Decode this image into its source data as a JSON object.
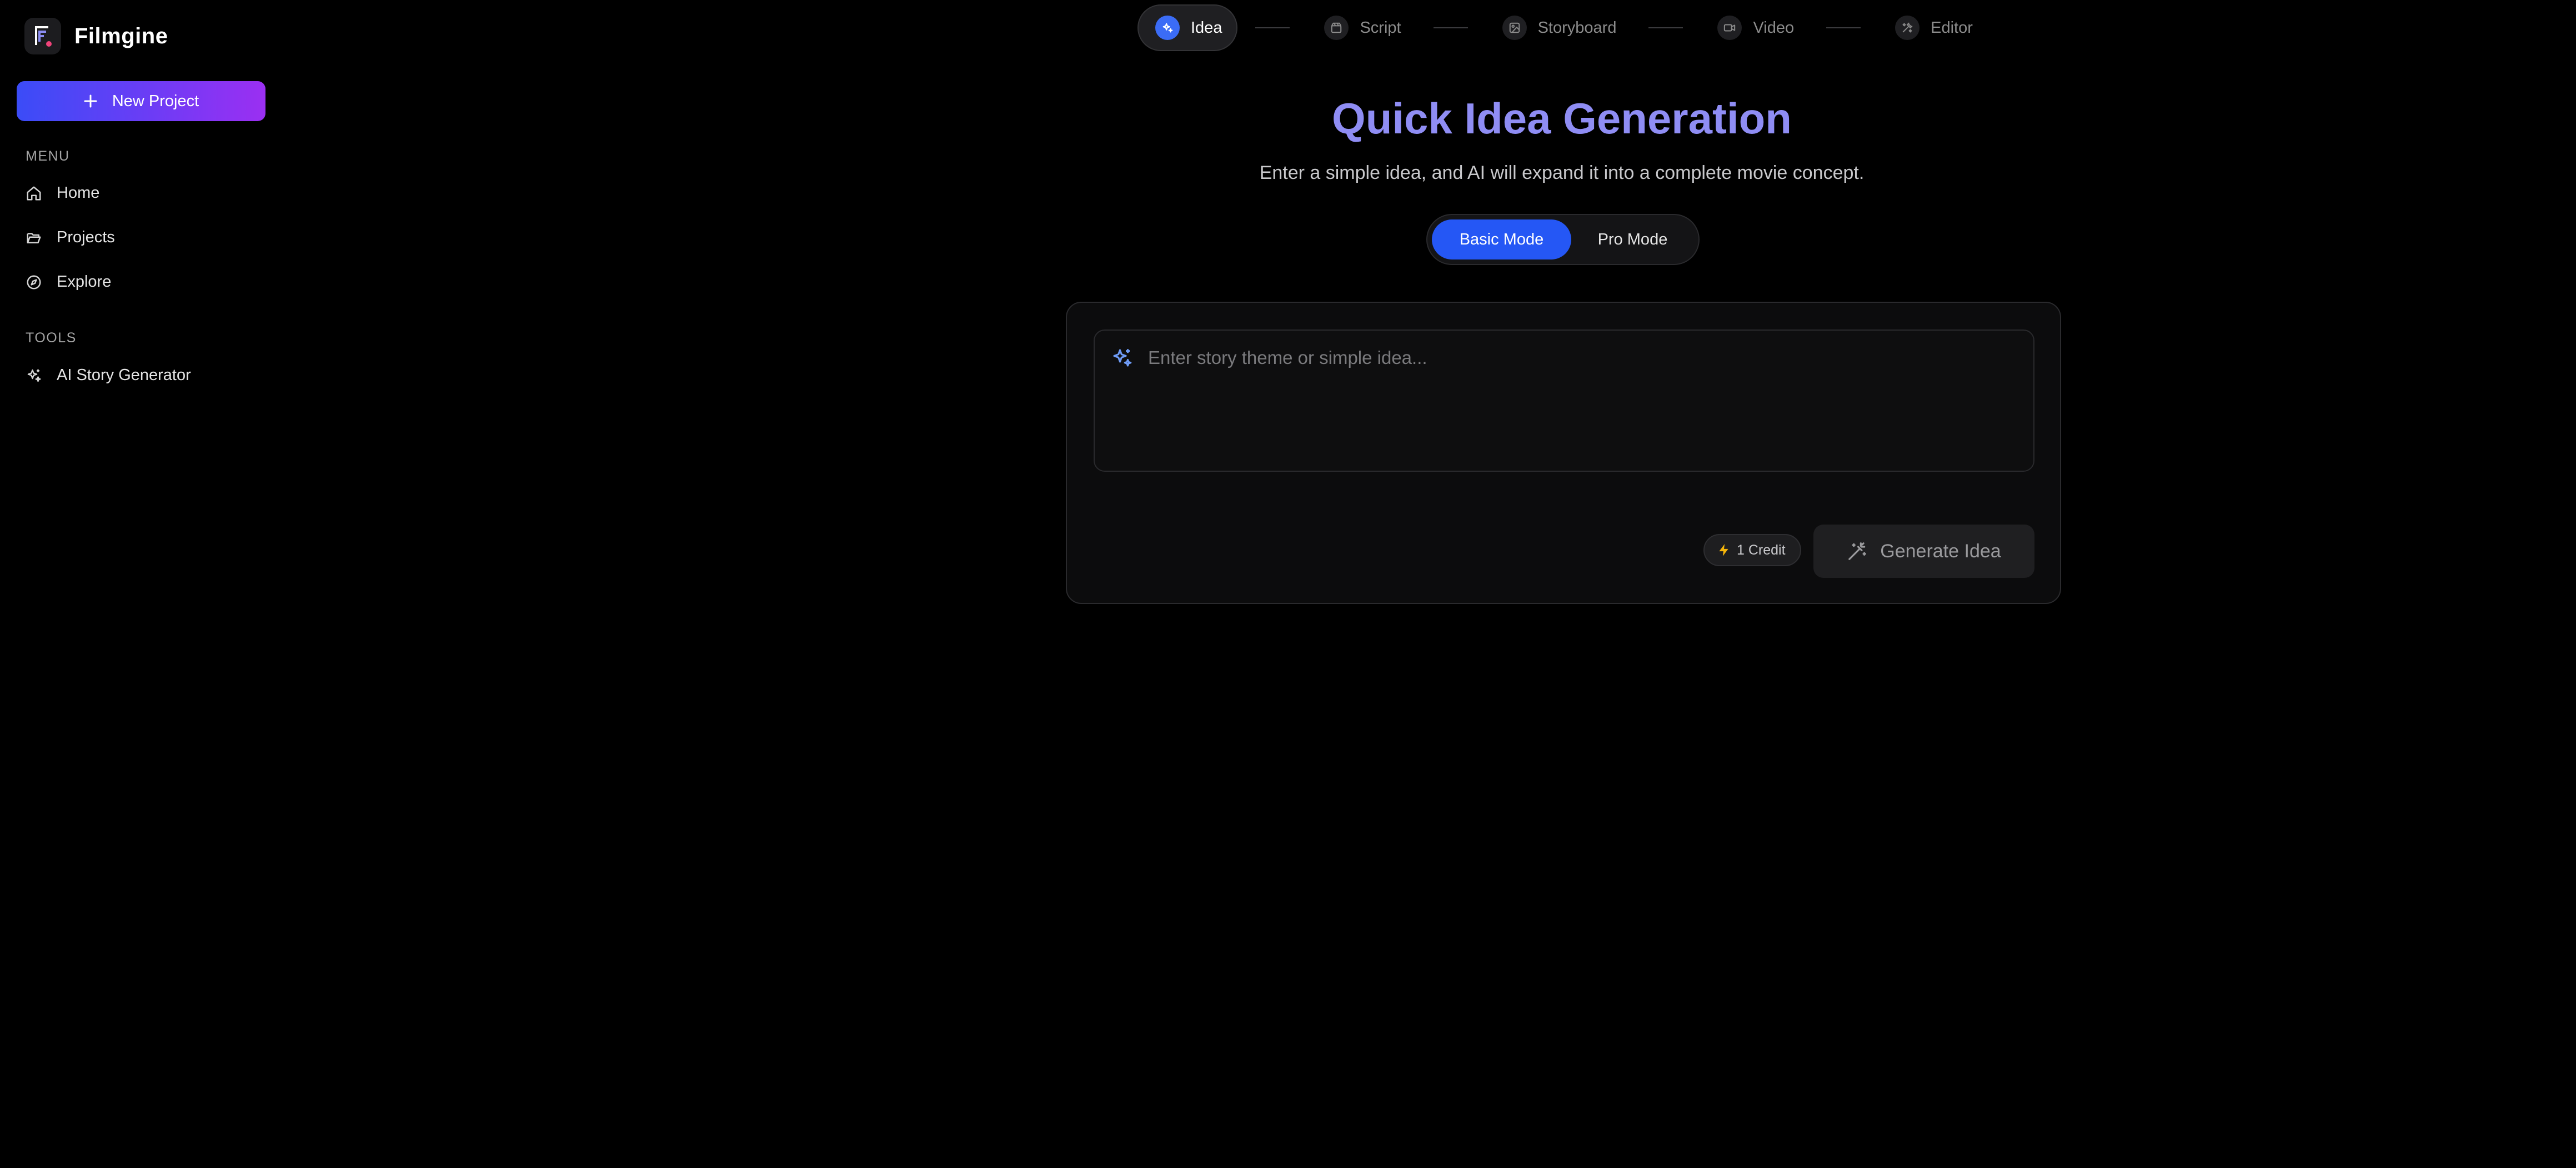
{
  "app": {
    "name": "Filmgine"
  },
  "sidebar": {
    "new_project_label": "New Project",
    "menu_label": "MENU",
    "menu_items": [
      {
        "label": "Home",
        "icon": "home-icon"
      },
      {
        "label": "Projects",
        "icon": "folder-open-icon"
      },
      {
        "label": "Explore",
        "icon": "compass-icon"
      }
    ],
    "tools_label": "TOOLS",
    "tool_items": [
      {
        "label": "AI Story Generator",
        "icon": "sparkles-icon"
      }
    ]
  },
  "stepper": {
    "steps": [
      {
        "label": "Idea",
        "icon": "sparkles-icon",
        "active": true
      },
      {
        "label": "Script",
        "icon": "clapperboard-icon",
        "active": false
      },
      {
        "label": "Storyboard",
        "icon": "image-frame-icon",
        "active": false
      },
      {
        "label": "Video",
        "icon": "video-camera-icon",
        "active": false
      },
      {
        "label": "Editor",
        "icon": "tools-icon",
        "active": false
      }
    ]
  },
  "main": {
    "title": "Quick Idea Generation",
    "subtitle": "Enter a simple idea, and AI will expand it into a complete movie concept.",
    "modes": {
      "basic": "Basic Mode",
      "pro": "Pro Mode",
      "selected": "Basic Mode"
    },
    "input": {
      "value": "",
      "placeholder": "Enter story theme or simple idea..."
    },
    "credit_label": "1 Credit",
    "generate_label": "Generate Idea"
  },
  "colors": {
    "accent_blue": "#2557f5",
    "title_purple": "#8f8df4",
    "gradient_start": "#3b4cf7",
    "gradient_end": "#9b2ff2",
    "credit_bolt": "#f5b50a"
  }
}
